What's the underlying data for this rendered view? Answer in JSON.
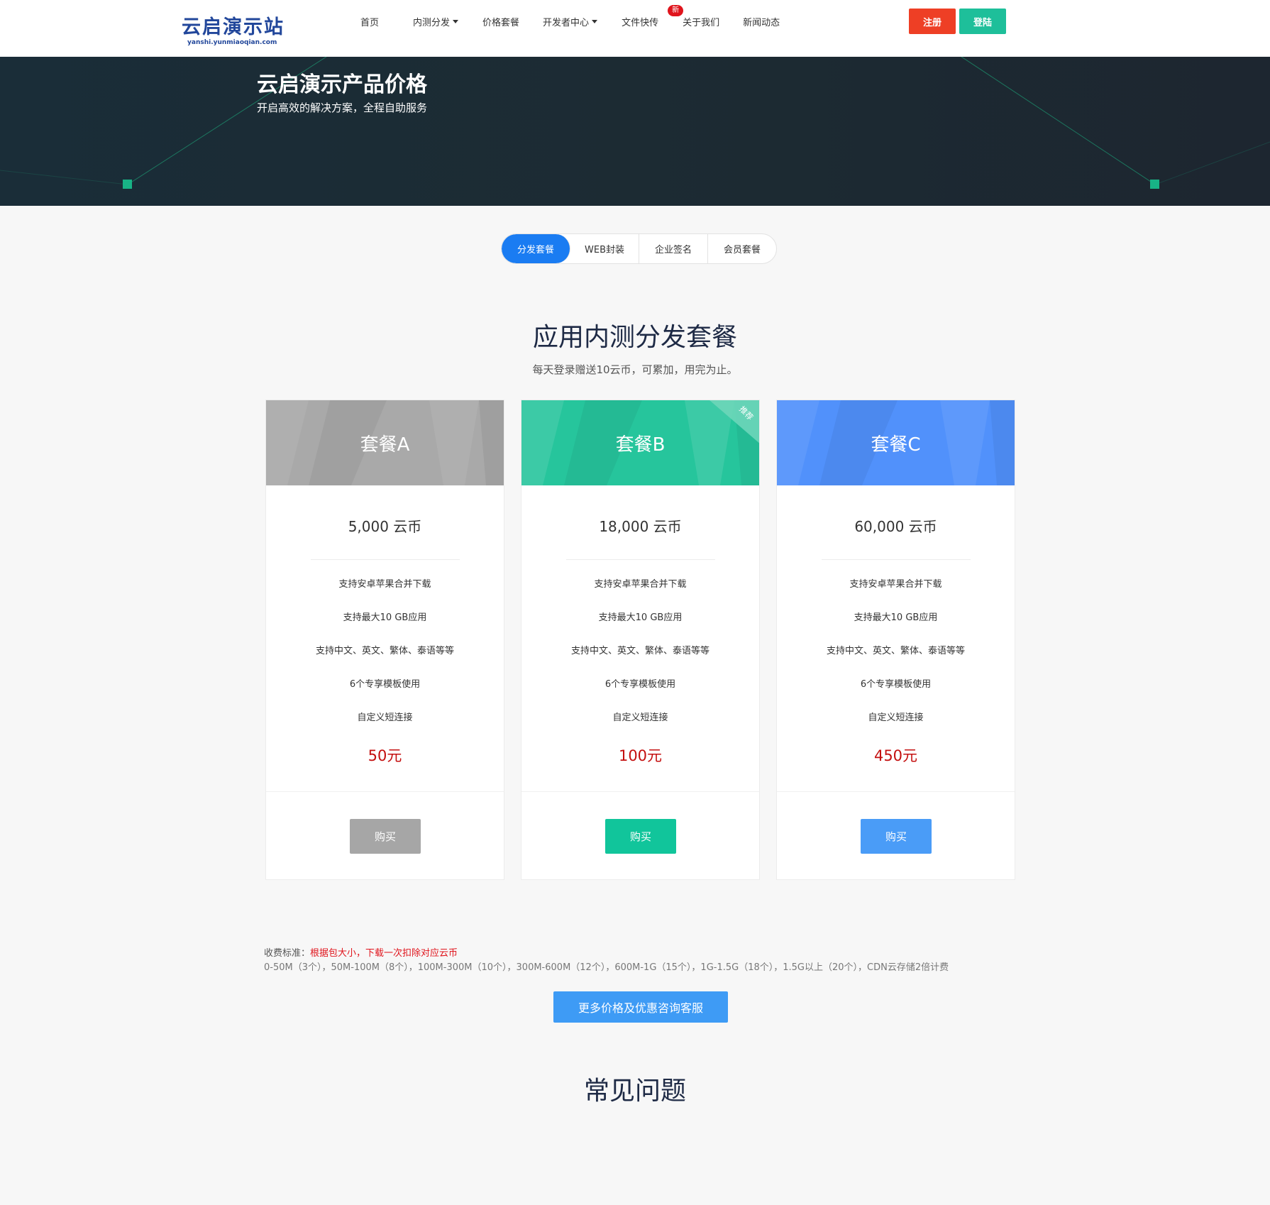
{
  "header": {
    "logo_main": "云启演示站",
    "logo_sub": "yanshi.yunmiaoqian.com",
    "nav": [
      {
        "label": "首页",
        "caret": false
      },
      {
        "label": "内测分发",
        "caret": true
      },
      {
        "label": "价格套餐",
        "caret": false
      },
      {
        "label": "开发者中心",
        "caret": true
      },
      {
        "label": "文件快传",
        "caret": false,
        "badge": "新"
      },
      {
        "label": "关于我们",
        "caret": false
      },
      {
        "label": "新闻动态",
        "caret": false
      }
    ],
    "register": "注册",
    "login": "登陆"
  },
  "banner": {
    "title": "云启演示产品价格",
    "subtitle": "开启高效的解决方案，全程自助服务"
  },
  "tabs": [
    "分发套餐",
    "WEB封装",
    "企业签名",
    "会员套餐"
  ],
  "section": {
    "title": "应用内测分发套餐",
    "subtitle": "每天登录赠送10云币，可累加，用完为止。"
  },
  "plans": [
    {
      "name": "套餐A",
      "coins": "5,000 云币",
      "features": [
        "支持安卓苹果合并下载",
        "支持最大10 GB应用",
        "支持中文、英文、繁体、泰语等等",
        "6个专享模板使用",
        "自定义短连接"
      ],
      "price": "50元",
      "buy": "购买",
      "ribbon": "",
      "head_color": "#a9a9a9",
      "btn_color": "#a6a6a6"
    },
    {
      "name": "套餐B",
      "coins": "18,000 云币",
      "features": [
        "支持安卓苹果合并下载",
        "支持最大10 GB应用",
        "支持中文、英文、繁体、泰语等等",
        "6个专享模板使用",
        "自定义短连接"
      ],
      "price": "100元",
      "buy": "购买",
      "ribbon": "推荐",
      "head_color": "#26c59c",
      "btn_color": "#11c59b"
    },
    {
      "name": "套餐C",
      "coins": "60,000 云币",
      "features": [
        "支持安卓苹果合并下载",
        "支持最大10 GB应用",
        "支持中文、英文、繁体、泰语等等",
        "6个专享模板使用",
        "自定义短连接"
      ],
      "price": "450元",
      "buy": "购买",
      "ribbon": "",
      "head_color": "#5191fb",
      "btn_color": "#4a9cf7"
    }
  ],
  "fee": {
    "label": "收费标准：",
    "highlight": "根据包大小，下载一次扣除对应云币",
    "detail": "0-50M（3个），50M-100M（8个），100M-300M（10个），300M-600M（12个），600M-1G（15个），1G-1.5G（18个），1.5G以上（20个），CDN云存储2倍计费"
  },
  "more_button": "更多价格及优惠咨询客服",
  "faq_title": "常见问题",
  "colors": {
    "accent": "#1a7cf2",
    "register": "#ee3f25",
    "login": "#1ebf9a",
    "price_red": "#c40f0f"
  }
}
